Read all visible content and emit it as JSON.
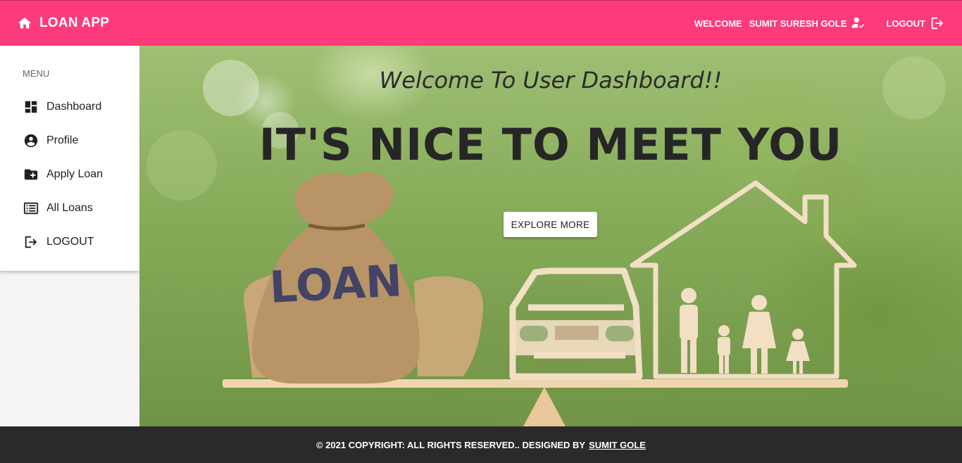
{
  "topbar": {
    "brand": "LOAN APP",
    "welcome_label": "WELCOME",
    "user_name": "SUMIT SURESH GOLE",
    "logout_label": "LOGOUT",
    "color": "#fe3a7a"
  },
  "sidebar": {
    "menu_title": "MENU",
    "items": [
      {
        "label": "Dashboard",
        "icon": "dashboard-icon"
      },
      {
        "label": "Profile",
        "icon": "account-circle-icon"
      },
      {
        "label": "Apply Loan",
        "icon": "folder-add-icon"
      },
      {
        "label": "All Loans",
        "icon": "list-icon"
      },
      {
        "label": "LOGOUT",
        "icon": "logout-icon"
      }
    ]
  },
  "hero": {
    "welcome_text": "Welcome To User Dashboard!!",
    "headline": "IT'S NICE TO MEET YOU",
    "button_label": "EXPLORE MORE",
    "bag_text": "LOAN"
  },
  "footer": {
    "text": "© 2021 COPYRIGHT: ALL RIGHTS RESERVED.. DESIGNED BY",
    "link_text": "SUMIT GOLE",
    "color": "#2a2a2c"
  }
}
